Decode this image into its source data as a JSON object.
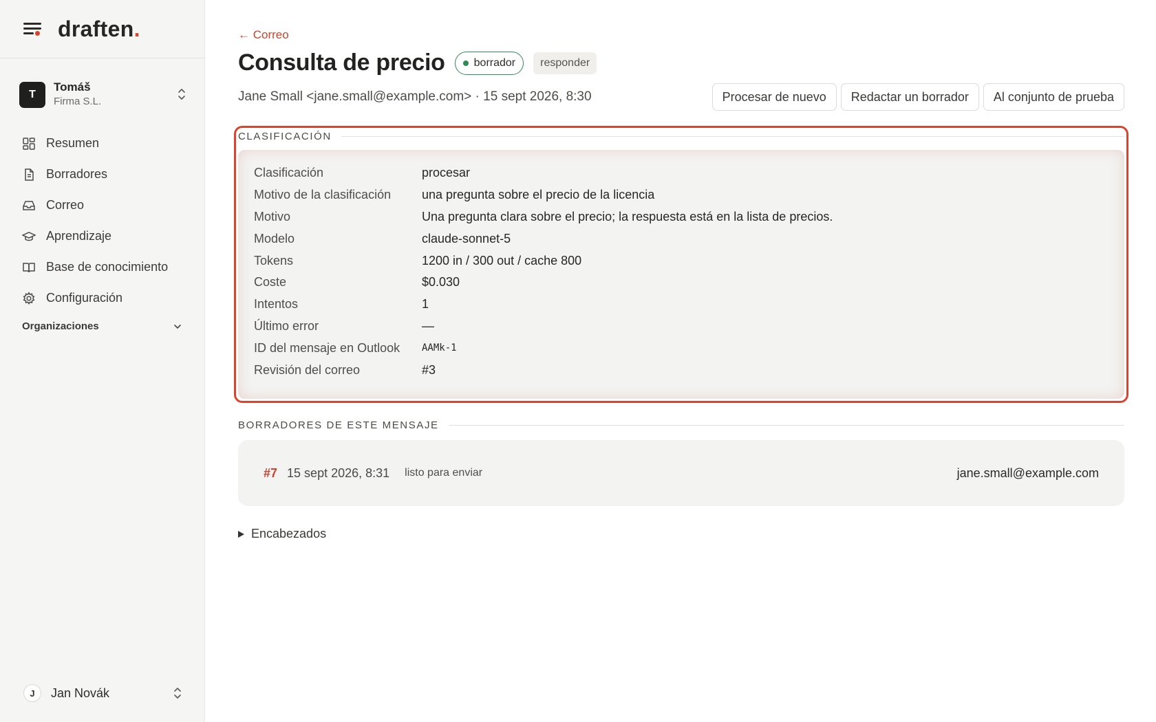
{
  "brand": {
    "name": "draften",
    "dot": "."
  },
  "account": {
    "initial": "T",
    "name": "Tomáš",
    "org": "Firma S.L."
  },
  "nav": {
    "items": [
      {
        "label": "Resumen",
        "icon": "dashboard-icon"
      },
      {
        "label": "Borradores",
        "icon": "document-icon"
      },
      {
        "label": "Correo",
        "icon": "inbox-icon"
      },
      {
        "label": "Aprendizaje",
        "icon": "graduation-cap-icon"
      },
      {
        "label": "Base de conocimiento",
        "icon": "book-icon"
      },
      {
        "label": "Configuración",
        "icon": "gear-icon"
      }
    ],
    "org_section": "Organizaciones"
  },
  "user": {
    "initial": "J",
    "name": "Jan Novák"
  },
  "header": {
    "back_link": "← Correo",
    "title": "Consulta de precio",
    "status_badge": "borrador",
    "tag_badge": "responder",
    "meta": "Jane Small <jane.small@example.com> · 15 sept 2026, 8:30",
    "actions": {
      "reprocess": "Procesar de nuevo",
      "compose": "Redactar un borrador",
      "to_test_set": "Al conjunto de prueba"
    }
  },
  "classification": {
    "heading": "CLASIFICACIÓN",
    "rows": [
      {
        "key": "Clasificación",
        "value": "procesar"
      },
      {
        "key": "Motivo de la clasificación",
        "value": "una pregunta sobre el precio de la licencia"
      },
      {
        "key": "Motivo",
        "value": "Una pregunta clara sobre el precio; la respuesta está en la lista de precios."
      },
      {
        "key": "Modelo",
        "value": "claude-sonnet-5"
      },
      {
        "key": "Tokens",
        "value": "1200 in / 300 out / cache 800"
      },
      {
        "key": "Coste",
        "value": "$0.030"
      },
      {
        "key": "Intentos",
        "value": "1"
      },
      {
        "key": "Último error",
        "value": "—"
      },
      {
        "key": "ID del mensaje en Outlook",
        "value": "AAMk-1"
      },
      {
        "key": "Revisión del correo",
        "value": "#3"
      }
    ]
  },
  "drafts": {
    "heading": "BORRADORES DE ESTE MENSAJE",
    "items": [
      {
        "number": "#7",
        "date": "15 sept 2026, 8:31",
        "status": "listo para enviar",
        "recipient": "jane.small@example.com"
      }
    ]
  },
  "headers_toggle": "Encabezados",
  "colors": {
    "accent": "#d8442c",
    "status_green": "#2f8a55",
    "highlight_frame": "#d94431"
  }
}
